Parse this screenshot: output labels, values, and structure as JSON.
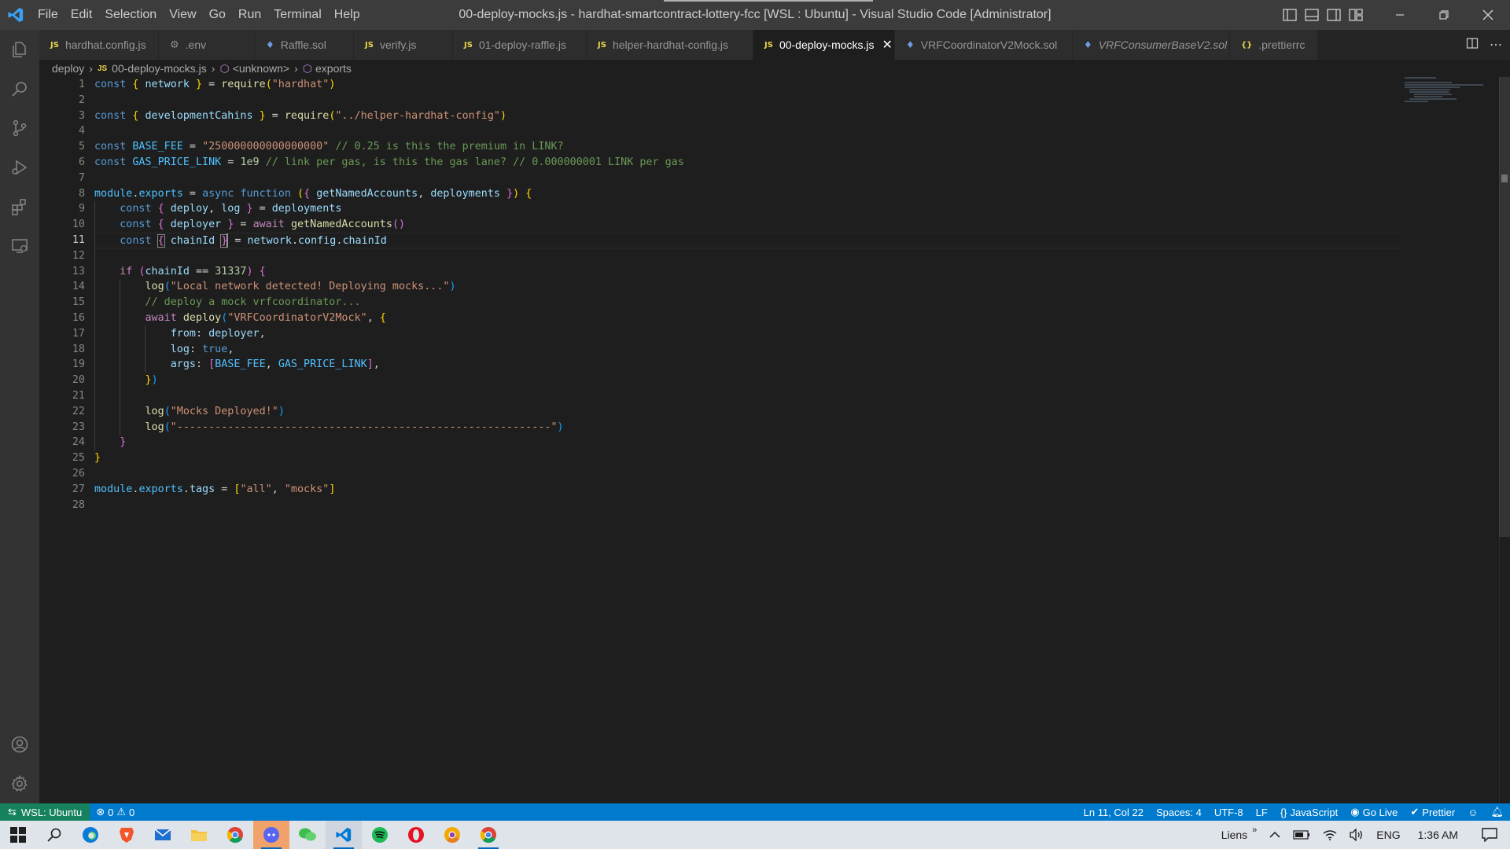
{
  "app": {
    "window_title": "00-deploy-mocks.js - hardhat-smartcontract-lottery-fcc [WSL : Ubuntu] - Visual Studio Code [Administrator]",
    "menu": [
      "File",
      "Edit",
      "Selection",
      "View",
      "Go",
      "Run",
      "Terminal",
      "Help"
    ]
  },
  "tabs": [
    {
      "label": "hardhat.config.js",
      "icon": "js-file-icon",
      "badge": "JS"
    },
    {
      "label": ".env",
      "icon": "gear-file-icon",
      "badge": "⚙"
    },
    {
      "label": "Raffle.sol",
      "icon": "solidity-file-icon",
      "badge": "♦"
    },
    {
      "label": "verify.js",
      "icon": "js-file-icon",
      "badge": "JS"
    },
    {
      "label": "01-deploy-raffle.js",
      "icon": "js-file-icon",
      "badge": "JS"
    },
    {
      "label": "helper-hardhat-config.js",
      "icon": "js-file-icon",
      "badge": "JS"
    },
    {
      "label": "00-deploy-mocks.js",
      "icon": "js-file-icon",
      "badge": "JS",
      "active": true
    },
    {
      "label": "VRFCoordinatorV2Mock.sol",
      "icon": "solidity-file-icon",
      "badge": "♦"
    },
    {
      "label": "VRFConsumerBaseV2.sol",
      "icon": "solidity-file-icon",
      "badge": "♦"
    },
    {
      "label": ".prettierrc",
      "icon": "json-file-icon",
      "badge": "{}"
    }
  ],
  "breadcrumb": {
    "folder": "deploy",
    "file": "00-deploy-mocks.js",
    "symbol1": "<unknown>",
    "symbol2": "exports"
  },
  "editor": {
    "language": "JavaScript",
    "current_line": 11,
    "line_count": 28
  },
  "statusbar": {
    "remote": "WSL: Ubuntu",
    "errors": "0",
    "warnings": "0",
    "position": "Ln 11, Col 22",
    "spaces": "Spaces: 4",
    "encoding": "UTF-8",
    "eol": "LF",
    "language": "JavaScript",
    "golive": "Go Live",
    "prettier": "Prettier"
  },
  "taskbar": {
    "links": "Liens",
    "lang": "ENG",
    "time": "1:36 AM"
  },
  "colors": {
    "statusbar": "#007acc",
    "remote": "#16825d",
    "titlebar": "#3c3c3c",
    "editor_bg": "#1e1e1e"
  }
}
